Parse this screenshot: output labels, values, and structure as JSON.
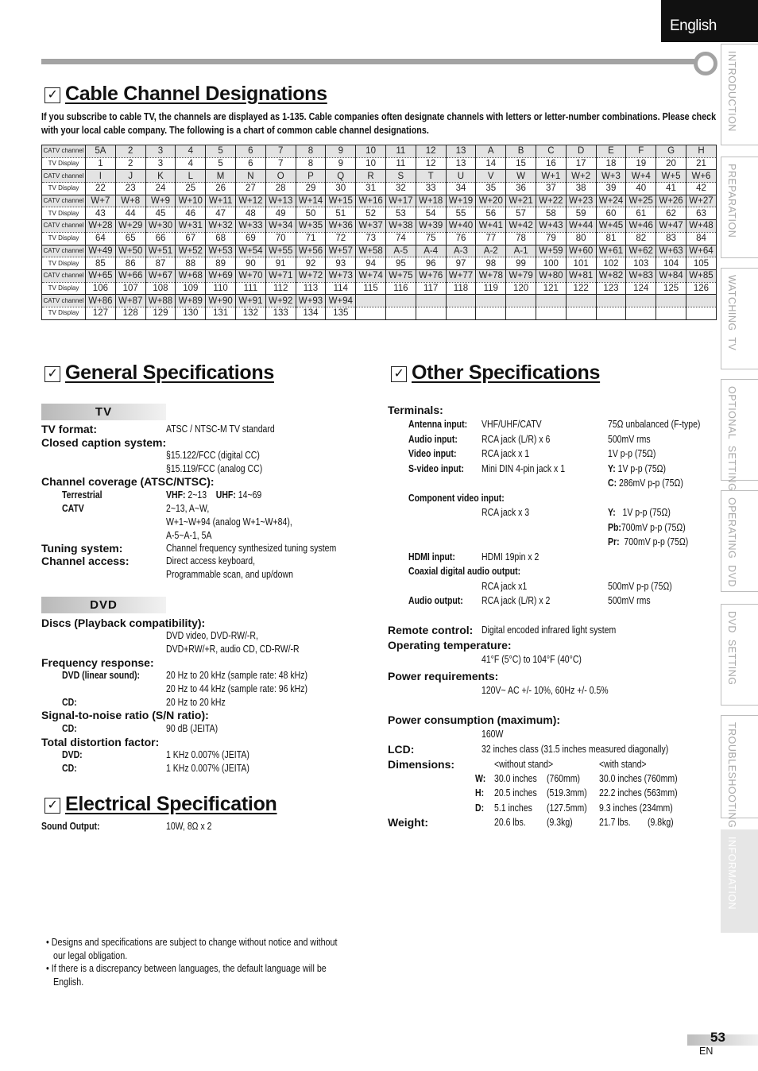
{
  "header": {
    "language": "English"
  },
  "side_tabs": [
    {
      "label": "INTRODUCTION",
      "active": false
    },
    {
      "label": "PREPARATION",
      "active": false
    },
    {
      "label": "WATCHING  TV",
      "active": false
    },
    {
      "label": "OPTIONAL  SETTING",
      "active": false
    },
    {
      "label": "OPERATING  DVD",
      "active": false
    },
    {
      "label": "DVD  SETTING",
      "active": false
    },
    {
      "label": "TROUBLESHOOTING",
      "active": false
    },
    {
      "label": "INFORMATION",
      "active": true
    }
  ],
  "cable": {
    "title": "Cable Channel Designations",
    "intro": "If you subscribe to cable TV, the channels are displayed as 1-135. Cable companies often designate channels with letters or letter-number combinations. Please check with your local cable company. The following is a chart of common cable channel designations.",
    "row_label_catv": "CATV channel",
    "row_label_display": "TV Display",
    "rows": [
      {
        "catv": [
          "5A",
          "2",
          "3",
          "4",
          "5",
          "6",
          "7",
          "8",
          "9",
          "10",
          "11",
          "12",
          "13",
          "A",
          "B",
          "C",
          "D",
          "E",
          "F",
          "G",
          "H"
        ],
        "display": [
          "1",
          "2",
          "3",
          "4",
          "5",
          "6",
          "7",
          "8",
          "9",
          "10",
          "11",
          "12",
          "13",
          "14",
          "15",
          "16",
          "17",
          "18",
          "19",
          "20",
          "21"
        ]
      },
      {
        "catv": [
          "I",
          "J",
          "K",
          "L",
          "M",
          "N",
          "O",
          "P",
          "Q",
          "R",
          "S",
          "T",
          "U",
          "V",
          "W",
          "W+1",
          "W+2",
          "W+3",
          "W+4",
          "W+5",
          "W+6"
        ],
        "display": [
          "22",
          "23",
          "24",
          "25",
          "26",
          "27",
          "28",
          "29",
          "30",
          "31",
          "32",
          "33",
          "34",
          "35",
          "36",
          "37",
          "38",
          "39",
          "40",
          "41",
          "42"
        ]
      },
      {
        "catv": [
          "W+7",
          "W+8",
          "W+9",
          "W+10",
          "W+11",
          "W+12",
          "W+13",
          "W+14",
          "W+15",
          "W+16",
          "W+17",
          "W+18",
          "W+19",
          "W+20",
          "W+21",
          "W+22",
          "W+23",
          "W+24",
          "W+25",
          "W+26",
          "W+27"
        ],
        "display": [
          "43",
          "44",
          "45",
          "46",
          "47",
          "48",
          "49",
          "50",
          "51",
          "52",
          "53",
          "54",
          "55",
          "56",
          "57",
          "58",
          "59",
          "60",
          "61",
          "62",
          "63"
        ]
      },
      {
        "catv": [
          "W+28",
          "W+29",
          "W+30",
          "W+31",
          "W+32",
          "W+33",
          "W+34",
          "W+35",
          "W+36",
          "W+37",
          "W+38",
          "W+39",
          "W+40",
          "W+41",
          "W+42",
          "W+43",
          "W+44",
          "W+45",
          "W+46",
          "W+47",
          "W+48"
        ],
        "display": [
          "64",
          "65",
          "66",
          "67",
          "68",
          "69",
          "70",
          "71",
          "72",
          "73",
          "74",
          "75",
          "76",
          "77",
          "78",
          "79",
          "80",
          "81",
          "82",
          "83",
          "84"
        ]
      },
      {
        "catv": [
          "W+49",
          "W+50",
          "W+51",
          "W+52",
          "W+53",
          "W+54",
          "W+55",
          "W+56",
          "W+57",
          "W+58",
          "A-5",
          "A-4",
          "A-3",
          "A-2",
          "A-1",
          "W+59",
          "W+60",
          "W+61",
          "W+62",
          "W+63",
          "W+64"
        ],
        "display": [
          "85",
          "86",
          "87",
          "88",
          "89",
          "90",
          "91",
          "92",
          "93",
          "94",
          "95",
          "96",
          "97",
          "98",
          "99",
          "100",
          "101",
          "102",
          "103",
          "104",
          "105"
        ]
      },
      {
        "catv": [
          "W+65",
          "W+66",
          "W+67",
          "W+68",
          "W+69",
          "W+70",
          "W+71",
          "W+72",
          "W+73",
          "W+74",
          "W+75",
          "W+76",
          "W+77",
          "W+78",
          "W+79",
          "W+80",
          "W+81",
          "W+82",
          "W+83",
          "W+84",
          "W+85"
        ],
        "display": [
          "106",
          "107",
          "108",
          "109",
          "110",
          "111",
          "112",
          "113",
          "114",
          "115",
          "116",
          "117",
          "118",
          "119",
          "120",
          "121",
          "122",
          "123",
          "124",
          "125",
          "126"
        ]
      },
      {
        "catv": [
          "W+86",
          "W+87",
          "W+88",
          "W+89",
          "W+90",
          "W+91",
          "W+92",
          "W+93",
          "W+94",
          "",
          "",
          "",
          "",
          "",
          "",
          "",
          "",
          "",
          "",
          "",
          ""
        ],
        "display": [
          "127",
          "128",
          "129",
          "130",
          "131",
          "132",
          "133",
          "134",
          "135",
          "",
          "",
          "",
          "",
          "",
          "",
          "",
          "",
          "",
          "",
          "",
          ""
        ]
      }
    ]
  },
  "general": {
    "title": "General Specifications",
    "tv_heading": "TV",
    "tv_format_label": "TV format:",
    "tv_format_value": "ATSC / NTSC-M TV standard",
    "cc_label": "Closed caption system:",
    "cc_values": [
      "§15.122/FCC (digital CC)",
      "§15.119/FCC (analog CC)"
    ],
    "coverage_label": "Channel coverage (ATSC/NTSC):",
    "terrestrial_label": "Terrestrial",
    "vhf_label": "VHF:",
    "vhf_value": "2~13",
    "uhf_label": "UHF:",
    "uhf_value": "14~69",
    "catv_label": "CATV",
    "catv_values": [
      "2~13, A~W,",
      "W+1~W+94 (analog W+1~W+84),",
      "A-5~A-1, 5A"
    ],
    "tuning_label": "Tuning system:",
    "tuning_value": "Channel frequency synthesized tuning system",
    "access_label": "Channel access:",
    "access_values": [
      "Direct access keyboard,",
      "Programmable scan, and up/down"
    ],
    "dvd_heading": "DVD",
    "discs_label": "Discs (Playback compatibility):",
    "discs_values": [
      "DVD video, DVD-RW/-R,",
      "DVD+RW/+R, audio CD, CD-RW/-R"
    ],
    "freq_label": "Frequency response:",
    "freq_dvd_label": "DVD (linear sound):",
    "freq_dvd_values": [
      "20 Hz to 20 kHz (sample rate: 48 kHz)",
      "20 Hz to 44 kHz (sample rate: 96 kHz)"
    ],
    "freq_cd_label": "CD:",
    "freq_cd_value": "20 Hz to 20 kHz",
    "sn_label": "Signal-to-noise ratio (S/N ratio):",
    "sn_cd_label": "CD:",
    "sn_cd_value": "90 dB (JEITA)",
    "tdf_label": "Total distortion factor:",
    "tdf_dvd_label": "DVD:",
    "tdf_dvd_value": "1 KHz  0.007% (JEITA)",
    "tdf_cd_label": "CD:",
    "tdf_cd_value": "1 KHz  0.007% (JEITA)"
  },
  "electrical": {
    "title": "Electrical Specification",
    "sound_label": "Sound Output:",
    "sound_value": "10W, 8Ω x 2"
  },
  "other": {
    "title": "Other Specifications",
    "terminals_label": "Terminals:",
    "antenna_label": "Antenna input:",
    "antenna_value": "VHF/UHF/CATV",
    "antenna_spec": "75Ω unbalanced (F-type)",
    "audio_in_label": "Audio input:",
    "audio_in_value": "RCA jack (L/R) x 6",
    "audio_in_spec": "500mV rms",
    "video_in_label": "Video input:",
    "video_in_value": "RCA jack x 1",
    "video_in_spec": "1V p-p (75Ω)",
    "svideo_label": "S-video input:",
    "svideo_value": "Mini DIN 4-pin jack x 1",
    "svideo_y_label": "Y:",
    "svideo_y_value": "1V p-p (75Ω)",
    "svideo_c_label": "C:",
    "svideo_c_value": "286mV p-p (75Ω)",
    "component_label": "Component video input:",
    "component_value": "RCA jack x 3",
    "comp_y_label": "Y:",
    "comp_y_value": "1V p-p (75Ω)",
    "comp_pb_label": "Pb:",
    "comp_pb_value": "700mV p-p (75Ω)",
    "comp_pr_label": "Pr:",
    "comp_pr_value": "700mV p-p (75Ω)",
    "hdmi_label": "HDMI input:",
    "hdmi_value": "HDMI 19pin x 2",
    "coax_label": "Coaxial digital audio output:",
    "coax_value": "RCA jack x1",
    "coax_spec": "500mV p-p (75Ω)",
    "audio_out_label": "Audio output:",
    "audio_out_value": "RCA jack (L/R) x 2",
    "audio_out_spec": "500mV rms",
    "remote_label": "Remote control:",
    "remote_value": "Digital encoded infrared light system",
    "optemp_label": "Operating temperature:",
    "optemp_value": "41°F (5°C) to 104°F (40°C)",
    "power_req_label": "Power requirements:",
    "power_req_value": "120V~ AC +/- 10%, 60Hz +/- 0.5%",
    "power_cons_label": "Power consumption (maximum):",
    "power_cons_value": "160W",
    "lcd_label": "LCD:",
    "lcd_value": "32 inches class  (31.5 inches measured diagonally)",
    "dim_label": "Dimensions:",
    "dim_without": "<without stand>",
    "dim_with": "<with stand>",
    "dims": [
      {
        "axis": "W:",
        "no_in": "30.0 inches",
        "no_mm": "(760mm)",
        "with": "30.0 inches (760mm)"
      },
      {
        "axis": "H:",
        "no_in": "20.5 inches",
        "no_mm": "(519.3mm)",
        "with": "22.2 inches (563mm)"
      },
      {
        "axis": "D:",
        "no_in": "5.1 inches",
        "no_mm": "(127.5mm)",
        "with": "9.3 inches   (234mm)"
      }
    ],
    "weight_label": "Weight:",
    "weight_no_lbs": "20.6 lbs.",
    "weight_no_kg": "(9.3kg)",
    "weight_with_lbs": "21.7 lbs.",
    "weight_with_kg": "(9.8kg)"
  },
  "footnotes": [
    "• Designs and specifications are subject to change without notice and without",
    "   our legal obligation.",
    "• If there is a discrepancy between languages, the default language will be",
    "   English."
  ],
  "page": {
    "number": "53",
    "lang_code": "EN"
  }
}
